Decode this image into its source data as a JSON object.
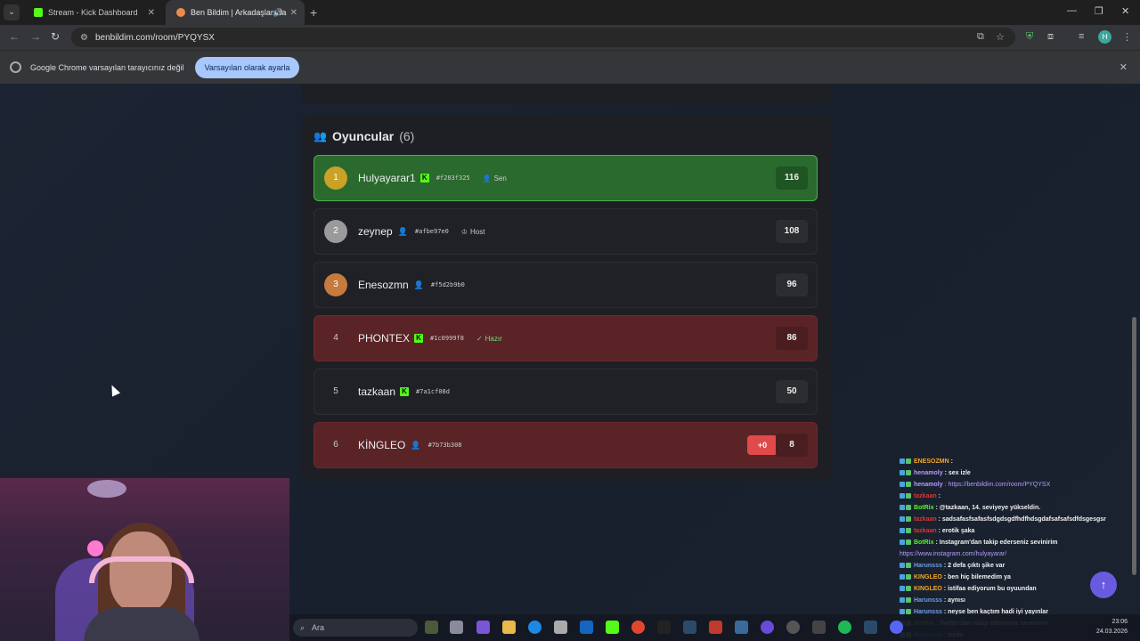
{
  "browser": {
    "tabs": [
      {
        "title": "Stream - Kick Dashboard",
        "color": "#53fc18"
      },
      {
        "title": "Ben Bildim | Arkadaşlarınla",
        "color": "#f08a4b"
      }
    ],
    "url": "benbildim.com/room/PYQYSX",
    "infobar": {
      "message": "Google Chrome varsayılan tarayıcınız değil",
      "button": "Varsayılan olarak ayarla"
    }
  },
  "players": {
    "title": "Oyuncular",
    "count": "(6)",
    "list": [
      {
        "rank": "1",
        "name": "Hulyayarar1",
        "kick": true,
        "hash": "#f283f325",
        "tag": "Sen",
        "score": "116",
        "style": "me",
        "medal": "gold"
      },
      {
        "rank": "2",
        "name": "zeynep",
        "kick": false,
        "hash": "#afbe97e0",
        "tag": "Host",
        "score": "108",
        "style": "normal",
        "medal": "silver"
      },
      {
        "rank": "3",
        "name": "Enesozmn",
        "kick": false,
        "hash": "#f5d2b9b0",
        "tag": "",
        "score": "96",
        "style": "normal",
        "medal": "bronze"
      },
      {
        "rank": "4",
        "name": "PHONTEX",
        "kick": true,
        "hash": "#1c0999f8",
        "tag": "Hazır",
        "score": "86",
        "style": "red",
        "medal": "plain"
      },
      {
        "rank": "5",
        "name": "tazkaan",
        "kick": true,
        "hash": "#7a1cf08d",
        "tag": "",
        "score": "50",
        "style": "normal",
        "medal": "plain"
      },
      {
        "rank": "6",
        "name": "KİNGLEO",
        "kick": false,
        "hash": "#7b73b308",
        "tag": "",
        "score": "8",
        "delta": "+0",
        "style": "red",
        "medal": "plain"
      }
    ]
  },
  "chat": [
    {
      "nick": "ENESOZMN",
      "color": "#f5a623",
      "text": ":",
      "kind": "text"
    },
    {
      "nick": "henamoly",
      "color": "#b49aff",
      "text": ": sex izle",
      "kind": "text"
    },
    {
      "nick": "henamoly",
      "color": "#b49aff",
      "text": ": https://benbildim.com/room/PYQYSX",
      "kind": "link"
    },
    {
      "nick": "tazkaan",
      "color": "#e0342f",
      "text": ":",
      "kind": "text"
    },
    {
      "nick": "BotRix",
      "color": "#53fc18",
      "text": ": @tazkaan, 14. seviyeye yükseldin.",
      "kind": "text"
    },
    {
      "nick": "tazkaan",
      "color": "#e0342f",
      "text": ": sadsafasfsafasfsdgdsgdfhdfhdsgdafsafsafsdfdsgesgsr",
      "kind": "text"
    },
    {
      "nick": "tazkaan",
      "color": "#e0342f",
      "text": ": erotik şaka",
      "kind": "text"
    },
    {
      "nick": "BotRix",
      "color": "#53fc18",
      "text": ": Instagram'dan takip ederseniz sevinirim",
      "kind": "text"
    },
    {
      "nick": "",
      "color": "#b49aff",
      "text": "https://www.instagram.com/hulyayarar/",
      "kind": "link"
    },
    {
      "nick": "Harunsss",
      "color": "#6f9ddf",
      "text": ": 2 defa çıktı şike var",
      "kind": "text"
    },
    {
      "nick": "KINGLEO",
      "color": "#f5a623",
      "text": ": ben hiç bilemedim ya",
      "kind": "text"
    },
    {
      "nick": "KINGLEO",
      "color": "#f5a623",
      "text": ": istifaa ediyorum bu oyuundan",
      "kind": "text"
    },
    {
      "nick": "Harunsss",
      "color": "#6f9ddf",
      "text": ": aynısı",
      "kind": "text"
    },
    {
      "nick": "Harunsss",
      "color": "#6f9ddf",
      "text": ": neyse ben kaçtım hadi iyi yayınlar",
      "kind": "text"
    },
    {
      "nick": "BotRix",
      "color": "#53fc18",
      "text": ": Twitter'dan takip ederseniz sevinirim",
      "kind": "text"
    },
    {
      "nick": "Harunsss",
      "color": "#6f9ddf",
      "text": ": sizde",
      "kind": "text"
    }
  ],
  "taskbar": {
    "search": "Ara",
    "date": "24.03.2026",
    "time": "23:06"
  },
  "colors": {
    "kick": "#53fc18",
    "me_row": "#2a6a2e",
    "red_row": "#5a2326",
    "accent": "#f08a4b"
  }
}
